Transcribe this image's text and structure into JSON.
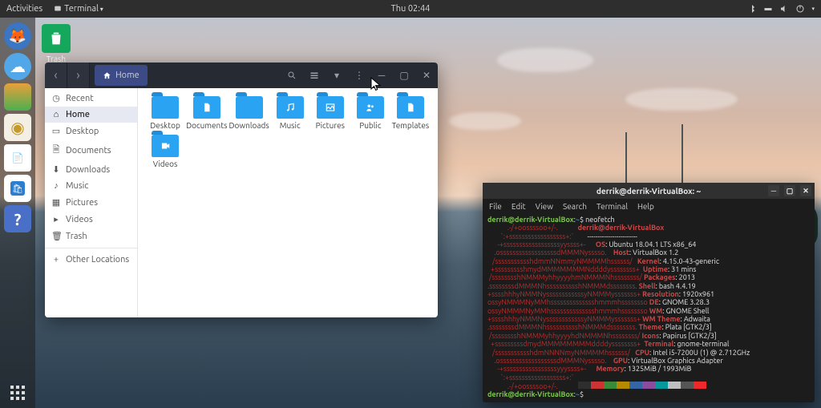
{
  "top_bar": {
    "activities": "Activities",
    "app_menu": "Terminal",
    "clock": "Thu 02:44"
  },
  "trash_label": "Trash",
  "file_manager": {
    "crumb": "Home",
    "sidebar": [
      {
        "icon": "clock",
        "label": "Recent"
      },
      {
        "icon": "home",
        "label": "Home",
        "active": true
      },
      {
        "icon": "desktop",
        "label": "Desktop"
      },
      {
        "icon": "doc",
        "label": "Documents"
      },
      {
        "icon": "down",
        "label": "Downloads"
      },
      {
        "icon": "music",
        "label": "Music"
      },
      {
        "icon": "pic",
        "label": "Pictures"
      },
      {
        "icon": "video",
        "label": "Videos"
      },
      {
        "icon": "trash",
        "label": "Trash"
      },
      {
        "icon": "plus",
        "label": "Other Locations",
        "other": true
      }
    ],
    "folders": [
      {
        "name": "Desktop",
        "icon": ""
      },
      {
        "name": "Documents",
        "icon": "doc"
      },
      {
        "name": "Downloads",
        "icon": "down"
      },
      {
        "name": "Music",
        "icon": "music"
      },
      {
        "name": "Pictures",
        "icon": "pic"
      },
      {
        "name": "Public",
        "icon": "people"
      },
      {
        "name": "Templates",
        "icon": "doc"
      },
      {
        "name": "Videos",
        "icon": "video"
      }
    ]
  },
  "terminal": {
    "title": "derrik@derrik-VirtualBox: ~",
    "menu": [
      "File",
      "Edit",
      "View",
      "Search",
      "Terminal",
      "Help"
    ],
    "prompt_user": "derrik@derrik-VirtualBox",
    "prompt_path": "~",
    "cmd": "neofetch",
    "info_title": "derrik@derrik-VirtualBox",
    "stats": [
      [
        "OS",
        "Ubuntu 18.04.1 LTS x86_64"
      ],
      [
        "Host",
        "VirtualBox 1.2"
      ],
      [
        "Kernel",
        "4.15.0-43-generic"
      ],
      [
        "Uptime",
        "31 mins"
      ],
      [
        "Packages",
        "2013"
      ],
      [
        "Shell",
        "bash 4.4.19"
      ],
      [
        "Resolution",
        "1920x961"
      ],
      [
        "DE",
        "GNOME 3.28.3"
      ],
      [
        "WM",
        "GNOME Shell"
      ],
      [
        "WM Theme",
        "Adwaita"
      ],
      [
        "Theme",
        "Plata [GTK2/3]"
      ],
      [
        "Icons",
        "Papirus [GTK2/3]"
      ],
      [
        "Terminal",
        "gnome-terminal"
      ],
      [
        "CPU",
        "Intel i5-7200U (1) @ 2.712GHz"
      ],
      [
        "GPU",
        "VirtualBox Graphics Adapter"
      ],
      [
        "Memory",
        "1325MiB / 1993MiB"
      ]
    ],
    "colors": [
      "#2e2e2e",
      "#cc3333",
      "#3a8a3a",
      "#b58900",
      "#3465a4",
      "#8a4d9e",
      "#06989a",
      "#bfbfbf",
      "#555",
      "#ef2929"
    ]
  }
}
